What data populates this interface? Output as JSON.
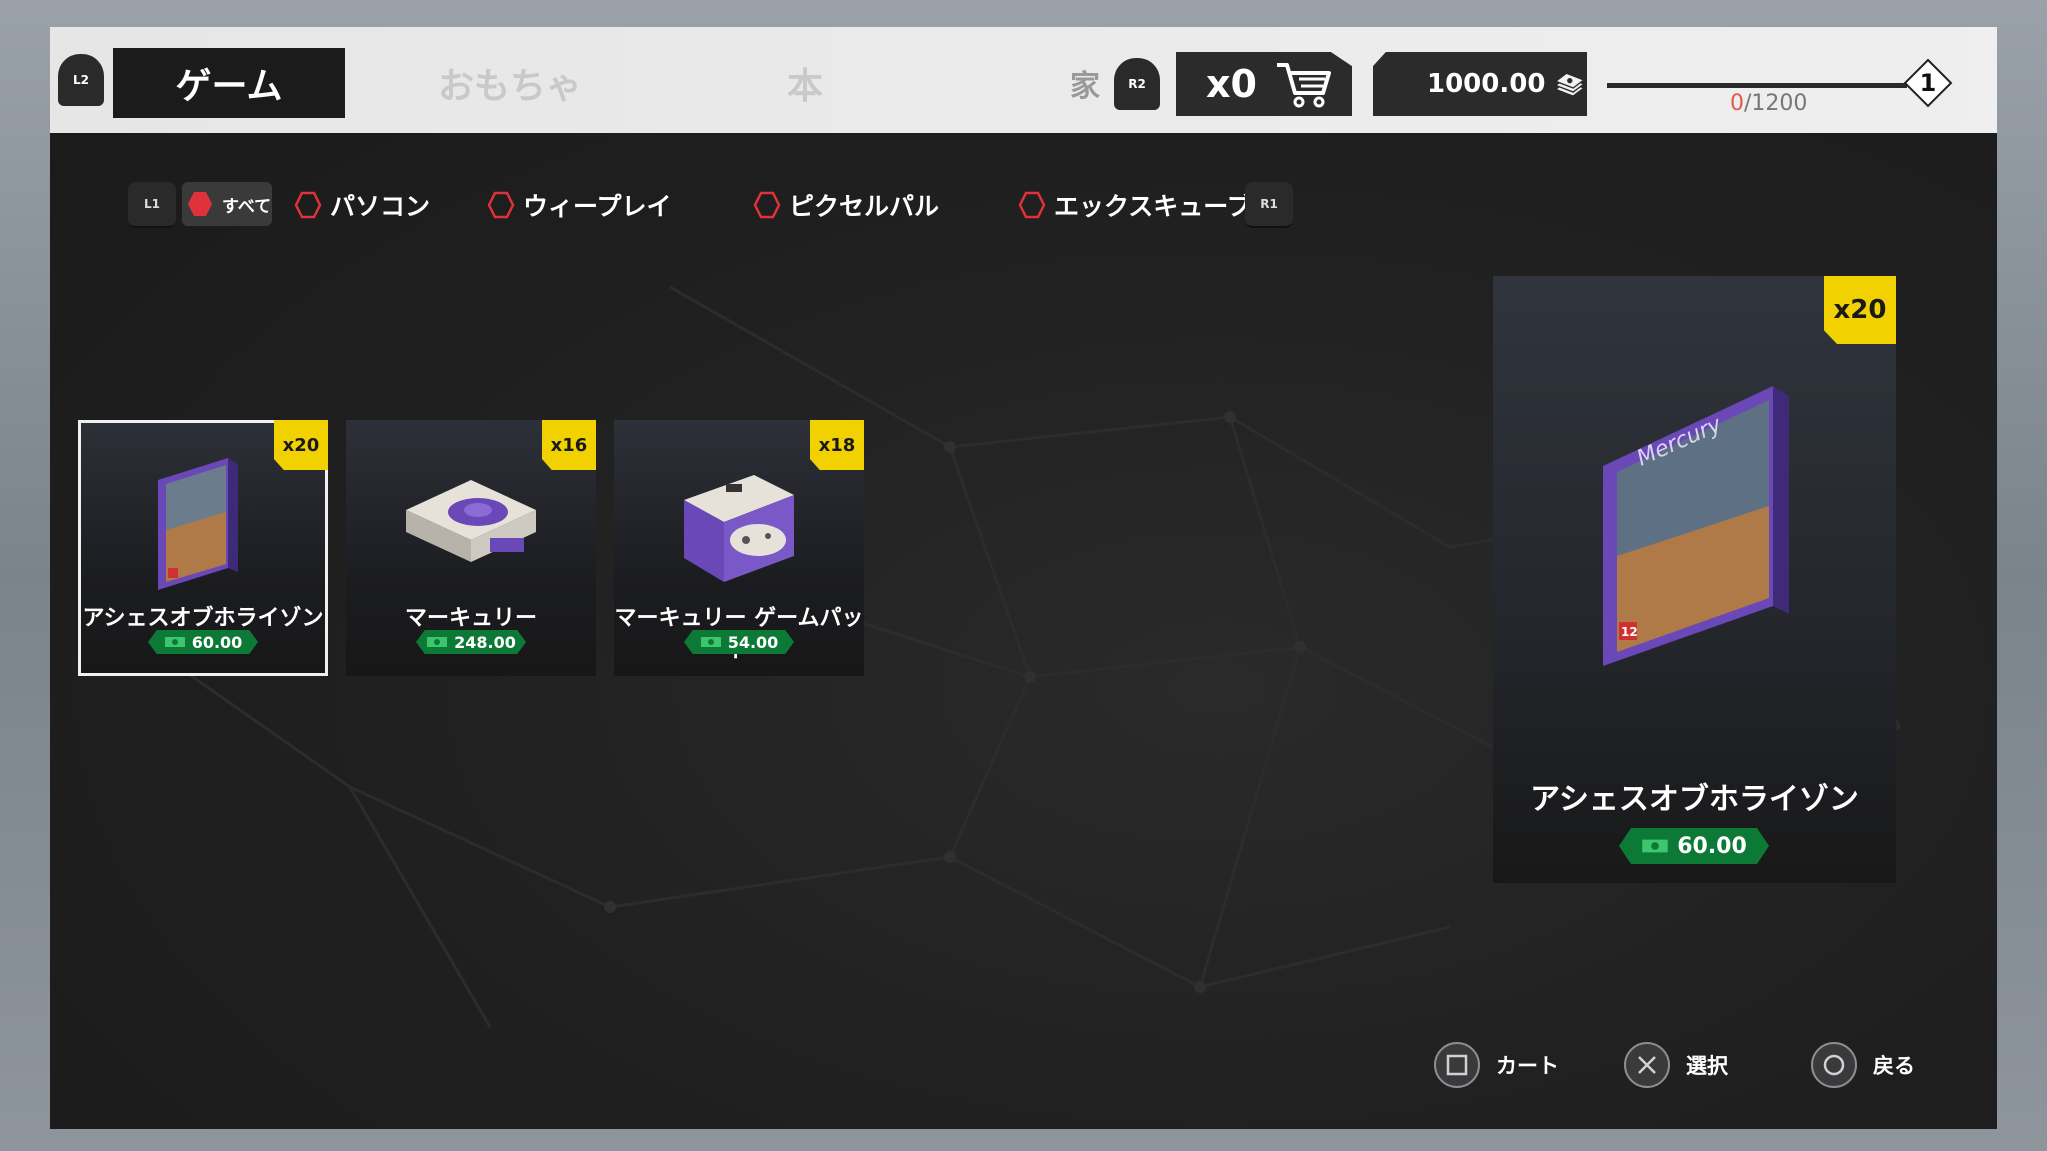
{
  "header": {
    "l2_label": "L2",
    "r2_label": "R2",
    "tabs": [
      {
        "label": "ゲーム",
        "active": true
      },
      {
        "label": "おもちゃ",
        "active": false
      },
      {
        "label": "本",
        "active": false
      },
      {
        "label": "家",
        "active": false
      }
    ],
    "cart_count": "x0",
    "money": "1000.00",
    "xp_current": "0",
    "xp_total": "/1200",
    "xp_progress": 0,
    "level": "1"
  },
  "filters": {
    "l1_label": "L1",
    "r1_label": "R1",
    "all_label": "すべて",
    "items": [
      "パソコン",
      "ウィープレイ",
      "ピクセルパル",
      "エックスキューブ"
    ]
  },
  "products": [
    {
      "name": "アシェスオブホライゾン",
      "price": "60.00",
      "stock": "x20",
      "selected": true
    },
    {
      "name": "マーキュリー",
      "price": "248.00",
      "stock": "x16",
      "selected": false
    },
    {
      "name": "マーキュリー ゲームパッド",
      "price": "54.00",
      "stock": "x18",
      "selected": false
    }
  ],
  "detail": {
    "name": "アシェスオブホライゾン",
    "price": "60.00",
    "stock": "x20",
    "box_brand": "Mercury",
    "box_rating": "12"
  },
  "footer": {
    "cart_label": "カート",
    "select_label": "選択",
    "back_label": "戻る"
  },
  "colors": {
    "accent_yellow": "#f1d200",
    "price_green": "#0c7a36",
    "filter_red": "#e0323a",
    "console_purple": "#6a48b8"
  }
}
